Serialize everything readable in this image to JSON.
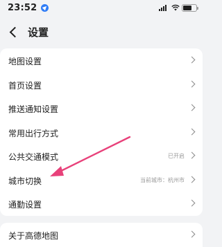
{
  "status_bar": {
    "time": "23:52",
    "location_icon": "location-arrow-icon",
    "signal_icon": "cellular-signal-icon",
    "wifi_icon": "wifi-icon",
    "battery_icon": "battery-icon"
  },
  "header": {
    "back_icon": "chevron-left-icon",
    "title": "设置"
  },
  "settings": {
    "items": [
      {
        "label": "地图设置",
        "value": ""
      },
      {
        "label": "首页设置",
        "value": ""
      },
      {
        "label": "推送通知设置",
        "value": ""
      },
      {
        "label": "常用出行方式",
        "value": ""
      },
      {
        "label": "公共交通模式",
        "value": "已开启"
      },
      {
        "label": "城市切换",
        "value": "当前城市：杭州市"
      },
      {
        "label": "通勤设置",
        "value": ""
      }
    ],
    "about": {
      "label": "关于高德地图",
      "value": ""
    }
  },
  "colors": {
    "background": "#f2f3f5",
    "card": "#ffffff",
    "annotation_arrow": "#e8417a",
    "location_blue": "#2f7cf6"
  }
}
